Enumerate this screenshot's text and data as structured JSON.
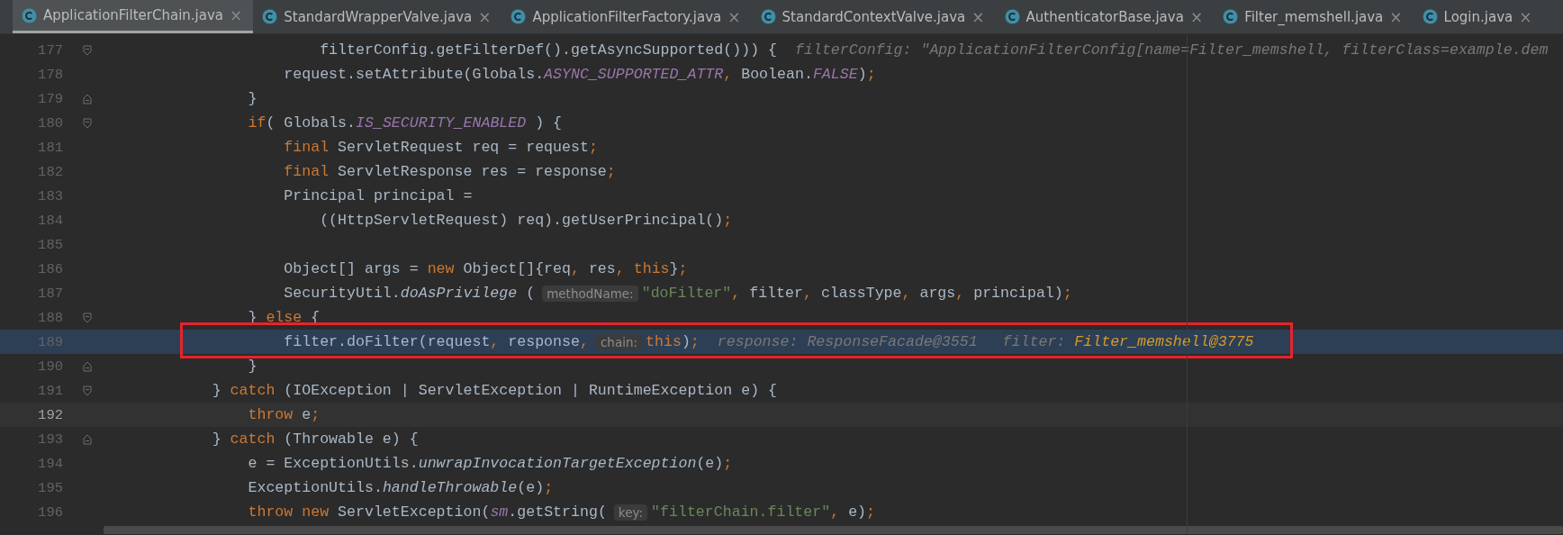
{
  "tabs": [
    {
      "label": "ApplicationFilterChain.java",
      "close": "×",
      "selected": true
    },
    {
      "label": "StandardWrapperValve.java",
      "close": "×",
      "selected": false
    },
    {
      "label": "ApplicationFilterFactory.java",
      "close": "×",
      "selected": false
    },
    {
      "label": "StandardContextValve.java",
      "close": "×",
      "selected": false
    },
    {
      "label": "AuthenticatorBase.java",
      "close": "×",
      "selected": false
    },
    {
      "label": "Filter_memshell.java",
      "close": "×",
      "selected": false
    },
    {
      "label": "Login.java",
      "close": "×",
      "selected": false
    }
  ],
  "editor": {
    "lines": [
      {
        "number": "177",
        "fold_start": true,
        "segments": [
          {
            "kind": "plain",
            "t": "                    filterConfig.getFilterDef().getAsyncSupported())) {"
          },
          {
            "kind": "debug",
            "t": "filterConfig: \"ApplicationFilterConfig[name=Filter_memshell, filterClass=example.dem"
          }
        ]
      },
      {
        "number": "178",
        "segments": [
          {
            "kind": "plain",
            "t": "                request.setAttribute(Globals."
          },
          {
            "kind": "const",
            "t": "ASYNC_SUPPORTED_ATTR"
          },
          {
            "kind": "punct",
            "t": ","
          },
          {
            "kind": "plain",
            "t": " Boolean."
          },
          {
            "kind": "const",
            "t": "FALSE"
          },
          {
            "kind": "plain",
            "t": ")"
          },
          {
            "kind": "punct",
            "t": ";"
          }
        ]
      },
      {
        "number": "179",
        "fold_end": true,
        "segments": [
          {
            "kind": "plain",
            "t": "            }"
          }
        ]
      },
      {
        "number": "180",
        "fold_start": true,
        "segments": [
          {
            "kind": "keyword",
            "t": "            if"
          },
          {
            "kind": "plain",
            "t": "( Globals."
          },
          {
            "kind": "const",
            "t": "IS_SECURITY_ENABLED"
          },
          {
            "kind": "plain",
            "t": " ) {"
          }
        ]
      },
      {
        "number": "181",
        "segments": [
          {
            "kind": "keyword",
            "t": "                final"
          },
          {
            "kind": "plain",
            "t": " ServletRequest req = request"
          },
          {
            "kind": "punct",
            "t": ";"
          }
        ]
      },
      {
        "number": "182",
        "segments": [
          {
            "kind": "keyword",
            "t": "                final"
          },
          {
            "kind": "plain",
            "t": " ServletResponse res = response"
          },
          {
            "kind": "punct",
            "t": ";"
          }
        ]
      },
      {
        "number": "183",
        "segments": [
          {
            "kind": "plain",
            "t": "                Principal principal ="
          }
        ]
      },
      {
        "number": "184",
        "segments": [
          {
            "kind": "plain",
            "t": "                    ((HttpServletRequest) req).getUserPrincipal()"
          },
          {
            "kind": "punct",
            "t": ";"
          }
        ]
      },
      {
        "number": "185"
      },
      {
        "number": "186",
        "segments": [
          {
            "kind": "plain",
            "t": "                Object[] args = "
          },
          {
            "kind": "keyword",
            "t": "new"
          },
          {
            "kind": "plain",
            "t": " Object[]{req"
          },
          {
            "kind": "punct",
            "t": ","
          },
          {
            "kind": "plain",
            "t": " res"
          },
          {
            "kind": "punct",
            "t": ","
          },
          {
            "kind": "keyword",
            "t": " this"
          },
          {
            "kind": "plain",
            "t": "}"
          },
          {
            "kind": "punct",
            "t": ";"
          }
        ]
      },
      {
        "number": "187",
        "segments": [
          {
            "kind": "plain",
            "t": "                SecurityUtil."
          },
          {
            "kind": "method",
            "t": "doAsPrivilege"
          },
          {
            "kind": "plain",
            "t": " ("
          },
          {
            "kind": "hint",
            "t": "methodName:"
          },
          {
            "kind": "string",
            "t": "\"doFilter\""
          },
          {
            "kind": "punct",
            "t": ","
          },
          {
            "kind": "plain",
            "t": " filter"
          },
          {
            "kind": "punct",
            "t": ","
          },
          {
            "kind": "plain",
            "t": " classType"
          },
          {
            "kind": "punct",
            "t": ","
          },
          {
            "kind": "plain",
            "t": " args"
          },
          {
            "kind": "punct",
            "t": ","
          },
          {
            "kind": "plain",
            "t": " principal)"
          },
          {
            "kind": "punct",
            "t": ";"
          }
        ]
      },
      {
        "number": "188",
        "fold_start": true,
        "segments": [
          {
            "kind": "plain",
            "t": "            }"
          },
          {
            "kind": "keyword",
            "t": " else"
          },
          {
            "kind": "plain",
            "t": " {"
          }
        ]
      },
      {
        "number": "189",
        "execution_point": true,
        "boxed": true,
        "segments": [
          {
            "kind": "plain",
            "t": "                filter.doFilter(request"
          },
          {
            "kind": "punct",
            "t": ","
          },
          {
            "kind": "plain",
            "t": " response"
          },
          {
            "kind": "punct",
            "t": ","
          },
          {
            "kind": "hint",
            "t": "chain:"
          },
          {
            "kind": "keyword",
            "t": "this"
          },
          {
            "kind": "plain",
            "t": ")"
          },
          {
            "kind": "punct",
            "t": ";"
          },
          {
            "kind": "debug",
            "t": "response: ResponseFacade@3551"
          },
          {
            "kind": "debug",
            "t": "filter:"
          },
          {
            "kind": "debugval",
            "t": "Filter_memshell@3775"
          }
        ]
      },
      {
        "number": "190",
        "fold_end": true,
        "segments": [
          {
            "kind": "plain",
            "t": "            }"
          }
        ]
      },
      {
        "number": "191",
        "fold_start": true,
        "segments": [
          {
            "kind": "plain",
            "t": "        }"
          },
          {
            "kind": "keyword",
            "t": " catch"
          },
          {
            "kind": "plain",
            "t": " (IOException | ServletException | RuntimeException e) {"
          }
        ]
      },
      {
        "number": "192",
        "caret_line": true,
        "segments": [
          {
            "kind": "keyword",
            "t": "            throw"
          },
          {
            "kind": "plain",
            "t": " e"
          },
          {
            "kind": "punct",
            "t": ";"
          }
        ]
      },
      {
        "number": "193",
        "fold_end": true,
        "segments": [
          {
            "kind": "plain",
            "t": "        }"
          },
          {
            "kind": "keyword",
            "t": " catch"
          },
          {
            "kind": "plain",
            "t": " (Throwable e) {"
          }
        ]
      },
      {
        "number": "194",
        "segments": [
          {
            "kind": "plain",
            "t": "            e = ExceptionUtils."
          },
          {
            "kind": "method",
            "t": "unwrapInvocationTargetException"
          },
          {
            "kind": "plain",
            "t": "(e)"
          },
          {
            "kind": "punct",
            "t": ";"
          }
        ]
      },
      {
        "number": "195",
        "segments": [
          {
            "kind": "plain",
            "t": "            ExceptionUtils."
          },
          {
            "kind": "method",
            "t": "handleThrowable"
          },
          {
            "kind": "plain",
            "t": "(e)"
          },
          {
            "kind": "punct",
            "t": ";"
          }
        ]
      },
      {
        "number": "196",
        "segments": [
          {
            "kind": "keyword",
            "t": "            throw new"
          },
          {
            "kind": "plain",
            "t": " ServletException("
          },
          {
            "kind": "const",
            "t": "sm"
          },
          {
            "kind": "plain",
            "t": ".getString("
          },
          {
            "kind": "hint",
            "t": "key:"
          },
          {
            "kind": "string",
            "t": "\"filterChain.filter\""
          },
          {
            "kind": "punct",
            "t": ","
          },
          {
            "kind": "plain",
            "t": " e)"
          },
          {
            "kind": "punct",
            "t": ";"
          }
        ]
      }
    ]
  }
}
